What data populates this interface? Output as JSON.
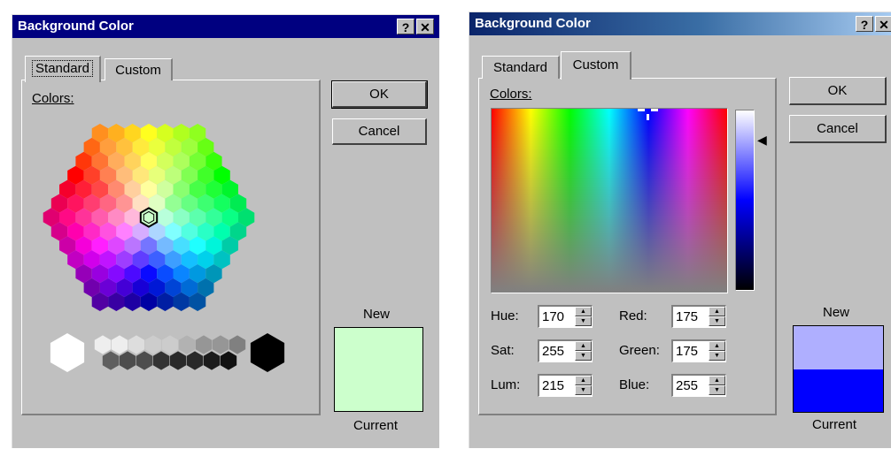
{
  "dialog_standard": {
    "title": "Background Color",
    "help_glyph": "?",
    "close_glyph": "✕",
    "tabs": [
      {
        "label": "Standard",
        "active": true
      },
      {
        "label": "Custom",
        "active": false
      }
    ],
    "colors_label": "Colors:",
    "ok_label": "OK",
    "cancel_label": "Cancel",
    "new_label": "New",
    "current_label": "Current",
    "new_color": "#ccffcc",
    "current_color": "#ccffcc",
    "selected_color": "#ccffcc",
    "grays": [
      "#ffffff",
      "#eeeeee",
      "#dddddd",
      "#cccccc",
      "#b2b2b2",
      "#969696",
      "#808080",
      "#5f5f5f",
      "#4d4d4d",
      "#333333",
      "#292929",
      "#1c1c1c",
      "#111111",
      "#080808",
      "#000000"
    ]
  },
  "dialog_custom": {
    "title": "Background Color",
    "help_glyph": "?",
    "close_glyph": "✕",
    "tabs": [
      {
        "label": "Standard",
        "active": false
      },
      {
        "label": "Custom",
        "active": true
      }
    ],
    "colors_label": "Colors:",
    "ok_label": "OK",
    "cancel_label": "Cancel",
    "new_label": "New",
    "current_label": "Current",
    "new_color": "#afafff",
    "current_color": "#0000ff",
    "fields": {
      "hue": {
        "label": "Hue:",
        "value": "170"
      },
      "sat": {
        "label": "Sat:",
        "value": "255"
      },
      "lum": {
        "label": "Lum:",
        "value": "215"
      },
      "red": {
        "label": "Red:",
        "value": "175"
      },
      "green": {
        "label": "Green:",
        "value": "175"
      },
      "blue": {
        "label": "Blue:",
        "value": "255"
      }
    },
    "spinner_up_icon": "▲",
    "spinner_down_icon": "▼",
    "luminance_pointer_icon": "◀"
  }
}
